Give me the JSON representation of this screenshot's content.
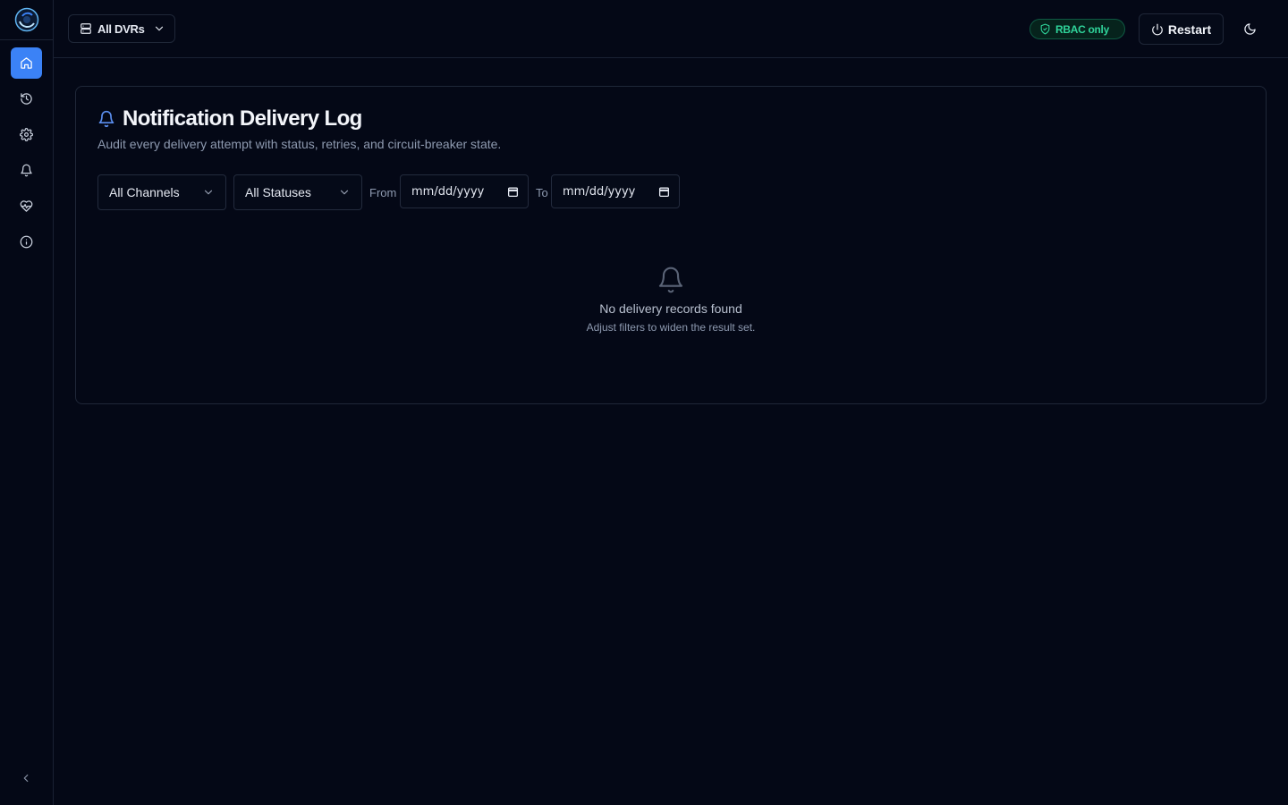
{
  "topbar": {
    "dvr_select_label": "All DVRs",
    "rbac_badge": "RBAC only",
    "restart_label": "Restart"
  },
  "sidebar": {
    "items": [
      {
        "icon": "home-icon",
        "active": true
      },
      {
        "icon": "history-icon",
        "active": false
      },
      {
        "icon": "gear-icon",
        "active": false
      },
      {
        "icon": "bell-icon",
        "active": false
      },
      {
        "icon": "heart-pulse-icon",
        "active": false
      },
      {
        "icon": "info-icon",
        "active": false
      }
    ]
  },
  "page": {
    "title": "Notification Delivery Log",
    "subtitle": "Audit every delivery attempt with status, retries, and circuit-breaker state."
  },
  "filters": {
    "channel": "All Channels",
    "status": "All Statuses",
    "from_label": "From",
    "to_label": "To",
    "from_placeholder": "mm/dd/yyyy",
    "to_placeholder": "mm/dd/yyyy"
  },
  "empty_state": {
    "title": "No delivery records found",
    "subtitle": "Adjust filters to widen the result set."
  },
  "colors": {
    "background": "#040816",
    "accent": "#3b82f6",
    "badge_green": "#2fd39a"
  }
}
